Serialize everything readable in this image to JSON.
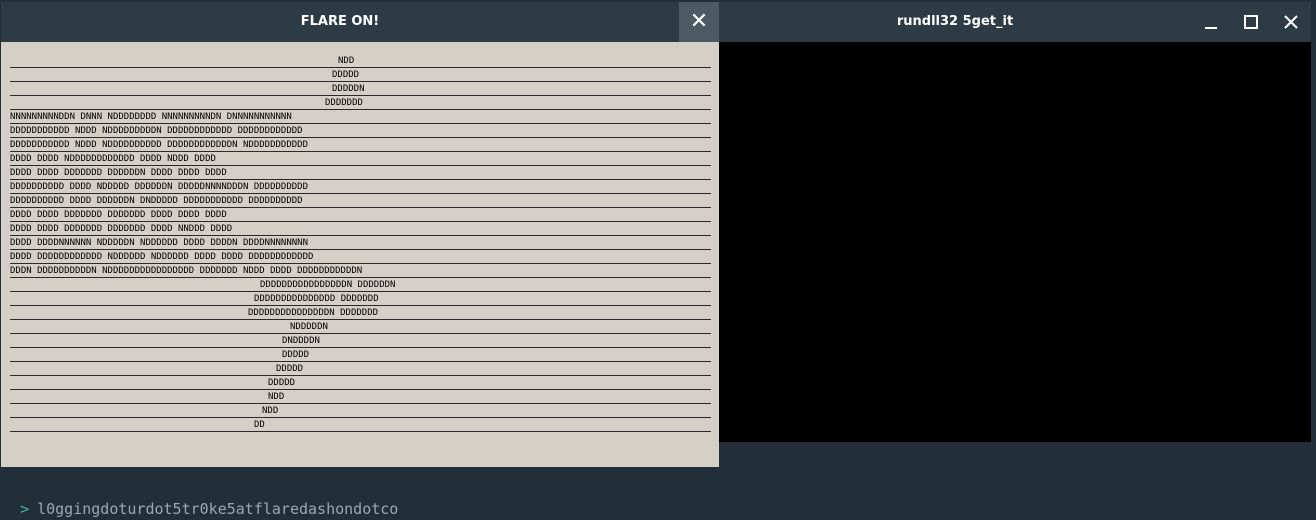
{
  "flare_window": {
    "title": "FLARE ON!",
    "close_glyph": "✕",
    "art_lines": [
      "NDD",
      "DDDDD",
      "DDDDDN",
      "DDDDDDD",
      "NNNNNNNNNDDN DNNN NDDDDDDDD NNNNNNNNNDN DNNNNNNNNNNN",
      "DDDDDDDDDDD NDDD NDDDDDDDDDN DDDDDDDDDDDD DDDDDDDDDDDD",
      "DDDDDDDDDDD NDDD NDDDDDDDDDD DDDDDDDDDDDDN NDDDDDDDDDDD",
      "DDDD DDDD NDDDDDDDDDDDD DDDD NDDD DDDD",
      "DDDD DDDD DDDDDDD DDDDDDN DDDD DDDD DDDD",
      "DDDDDDDDDD DDDD NDDDDD DDDDDDN DDDDDNNNNDDDN DDDDDDDDDD",
      "DDDDDDDDDD DDDD DDDDDDN DNDDDDD DDDDDDDDDDD DDDDDDDDDD",
      "DDDD DDDD DDDDDDD DDDDDDD DDDD DDDD DDDD",
      "DDDD DDDD DDDDDDD DDDDDDD DDDD NNDDD DDDD",
      "DDDD DDDDNNNNNN NDDDDDN NDDDDDD DDDD DDDDN DDDDNNNNNNNN",
      "DDDD DDDDDDDDDDDD NDDDDDD NDDDDDD DDDD DDDD DDDDDDDDDDDD",
      "DDDN DDDDDDDDDDN NDDDDDDDDDDDDDDDD DDDDDDD NDDD DDDD DDDDDDDDDDDN",
      "DDDDDDDDDDDDDDDDN DDDDDDN",
      "DDDDDDDDDDDDDDD DDDDDDD",
      "DDDDDDDDDDDDDDDN DDDDDDD",
      "NDDDDDN",
      "DNDDDDN",
      "DDDDD",
      "DDDDD",
      "DDDDD",
      "NDD",
      "NDD",
      "DD"
    ]
  },
  "rundll_window": {
    "title": "rundll32 5get_it"
  },
  "terminal": {
    "prompt": ">",
    "text": "l0ggingdoturdot5tr0ke5atflaredashondotco"
  },
  "colors": {
    "desktop_bg": "#222e38",
    "titlebar_bg": "#2d3b44",
    "flare_canvas_bg": "#d4d0c8",
    "close_button_bg": "#4b5a63",
    "prompt_accent": "#3fb6a8"
  },
  "icons": {
    "flare_close": "close-icon",
    "rundll_minimize": "minimize-icon",
    "rundll_maximize": "maximize-icon",
    "rundll_close": "close-icon"
  }
}
